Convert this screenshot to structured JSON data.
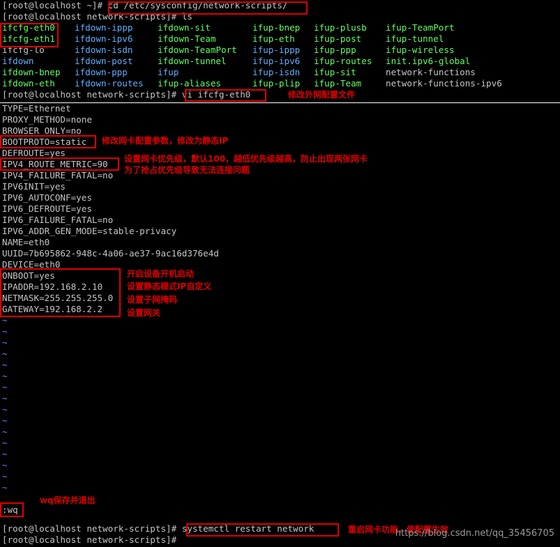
{
  "top": {
    "prompt_cd": "[root@localhost ~]#",
    "cmd_cd": "cd /etc/sysconfig/network-scripts/",
    "prompt_ls": "[root@localhost network-scripts]#",
    "cmd_ls": "ls",
    "files": [
      [
        "ifcfg-eth0",
        "ifdown-ippp",
        "ifdown-sit",
        "ifup-bnep",
        "ifup-plusb",
        "ifup-TeamPort"
      ],
      [
        "ifcfg-eth1",
        "ifdown-ipv6",
        "ifdown-Team",
        "ifup-eth",
        "ifup-post",
        "ifup-tunnel"
      ],
      [
        "ifcfg-lo",
        "ifdown-isdn",
        "ifdown-TeamPort",
        "ifup-ippp",
        "ifup-ppp",
        "ifup-wireless"
      ],
      [
        "ifdown",
        "ifdown-post",
        "ifdown-tunnel",
        "ifup-ipv6",
        "ifup-routes",
        "init.ipv6-global"
      ],
      [
        "ifdown-bnep",
        "ifdown-ppp",
        "ifup",
        "ifup-isdn",
        "ifup-sit",
        "network-functions"
      ],
      [
        "ifdown-eth",
        "ifdown-routes",
        "ifup-aliases",
        "ifup-plip",
        "ifup-Team",
        "network-functions-ipv6"
      ]
    ],
    "prompt_vi": "[root@localhost network-scripts]#",
    "cmd_vi": "vi ifcfg-eth0"
  },
  "vi": {
    "lines": [
      "TYPE=Ethernet",
      "PROXY_METHOD=none",
      "BROWSER_ONLY=no",
      "BOOTPROTO=static",
      "DEFROUTE=yes",
      "IPV4_ROUTE_METRIC=90",
      "IPV4_FAILURE_FATAL=no",
      "IPV6INIT=yes",
      "IPV6_AUTOCONF=yes",
      "IPV6_DEFROUTE=yes",
      "IPV6_FAILURE_FATAL=no",
      "IPV6_ADDR_GEN_MODE=stable-privacy",
      "NAME=eth0",
      "UUID=7b695862-948c-4a06-ae37-9ac16d376e4d",
      "DEVICE=eth0",
      "ONBOOT=yes",
      "IPADDR=192.168.2.10",
      "NETMASK=255.255.255.0",
      "GATEWAY=192.168.2.2"
    ],
    "tilde": "~",
    "command": ":wq"
  },
  "bottom": {
    "prompt1": "[root@localhost network-scripts]#",
    "cmd1": "systemctl restart network",
    "prompt2": "[root@localhost network-scripts]#"
  },
  "annotations": {
    "edit_file": "修改外网配置文件",
    "bootproto": "修改网卡配置参数，修改为静态IP",
    "metric": "设置网卡优先级，默认100，越低优先级越高，防止出现两张网卡\n为了抢占优先级导致无法连接问题",
    "onboot": "开启设备开机启动",
    "ipaddr": "设置静态模式IP自定义",
    "netmask": "设置子网掩码",
    "gateway": "设置网关",
    "wq": "wq保存并退出",
    "restart": "重启网卡功能，使配置生效"
  },
  "watermark": "https://blog.csdn.net/qq_35456705",
  "colors": {
    "annotation": "#e00000",
    "file_green": "#5fff5f",
    "file_blue": "#5fafff",
    "tilde": "#5f87ff"
  }
}
